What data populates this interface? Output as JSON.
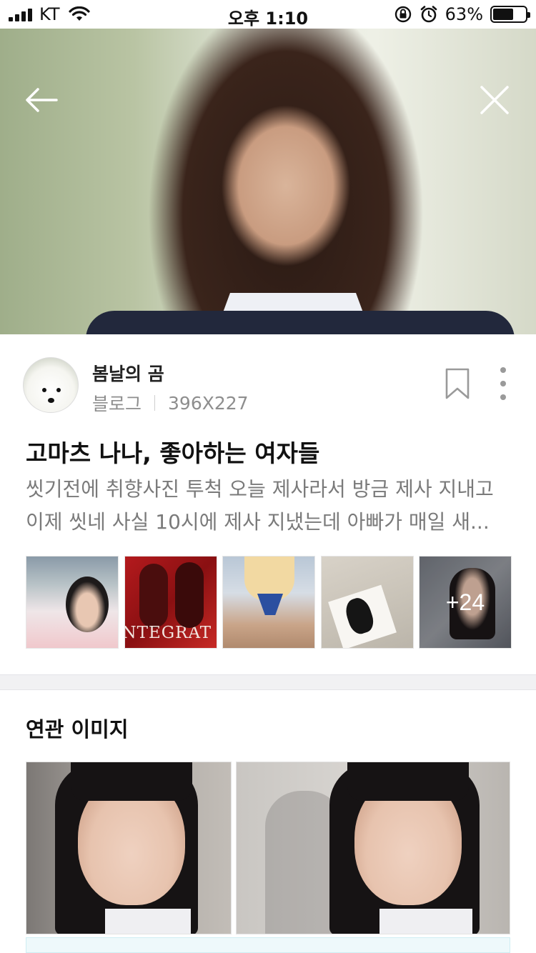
{
  "status_bar": {
    "carrier": "KT",
    "time": "오후 1:10",
    "battery_percent": "63%",
    "battery_level": 0.63,
    "icons": [
      "signal-icon",
      "wifi-icon",
      "orientation-lock-icon",
      "alarm-icon",
      "battery-icon"
    ]
  },
  "hero": {
    "back_icon": "back-arrow-icon",
    "close_icon": "close-icon"
  },
  "post": {
    "author": "봄날의 곰",
    "source": "블로그",
    "dimensions": "396X227",
    "title": "고마츠 나나, 좋아하는 여자들",
    "body_line_1": "씻기전에 취향사진 투척 오늘 제사라서 방금 제사 지내고",
    "body_line_2": "이제 씻네 사실 10시에 제사 지냈는데 아빠가 매일 새...",
    "bookmark_icon": "bookmark-icon",
    "more_icon": "more-vertical-icon",
    "thumbnails": [
      {
        "text": ""
      },
      {
        "text": "NTEGRAT"
      },
      {
        "text": ""
      },
      {
        "text": ""
      },
      {
        "text": "+24"
      }
    ]
  },
  "related": {
    "title": "연관 이미지"
  },
  "colors": {
    "muted_text": "#8e8e8e",
    "divider": "#f1f1f3"
  }
}
